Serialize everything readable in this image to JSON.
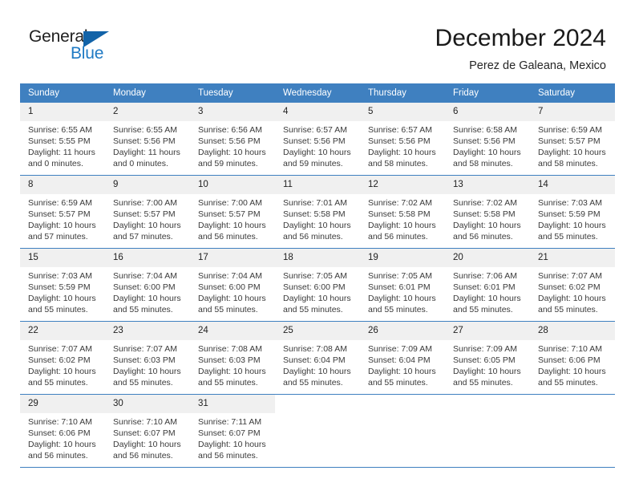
{
  "brand": {
    "name_top": "General",
    "name_bottom": "Blue",
    "triangle_icon": "triangle-icon",
    "accent_color": "#1263a8",
    "text_color": "#1f7ac4"
  },
  "header": {
    "title": "December 2024",
    "location": "Perez de Galeana, Mexico"
  },
  "calendar": {
    "header_bg": "#3f80c0",
    "header_text_color": "#ffffff",
    "daynum_bg": "#f0f0f0",
    "weekdays": [
      "Sunday",
      "Monday",
      "Tuesday",
      "Wednesday",
      "Thursday",
      "Friday",
      "Saturday"
    ],
    "labels": {
      "sunrise": "Sunrise:",
      "sunset": "Sunset:",
      "daylight": "Daylight:"
    },
    "weeks": [
      [
        {
          "day": "1",
          "sunrise": "Sunrise: 6:55 AM",
          "sunset": "Sunset: 5:55 PM",
          "daylight1": "Daylight: 11 hours",
          "daylight2": "and 0 minutes."
        },
        {
          "day": "2",
          "sunrise": "Sunrise: 6:55 AM",
          "sunset": "Sunset: 5:56 PM",
          "daylight1": "Daylight: 11 hours",
          "daylight2": "and 0 minutes."
        },
        {
          "day": "3",
          "sunrise": "Sunrise: 6:56 AM",
          "sunset": "Sunset: 5:56 PM",
          "daylight1": "Daylight: 10 hours",
          "daylight2": "and 59 minutes."
        },
        {
          "day": "4",
          "sunrise": "Sunrise: 6:57 AM",
          "sunset": "Sunset: 5:56 PM",
          "daylight1": "Daylight: 10 hours",
          "daylight2": "and 59 minutes."
        },
        {
          "day": "5",
          "sunrise": "Sunrise: 6:57 AM",
          "sunset": "Sunset: 5:56 PM",
          "daylight1": "Daylight: 10 hours",
          "daylight2": "and 58 minutes."
        },
        {
          "day": "6",
          "sunrise": "Sunrise: 6:58 AM",
          "sunset": "Sunset: 5:56 PM",
          "daylight1": "Daylight: 10 hours",
          "daylight2": "and 58 minutes."
        },
        {
          "day": "7",
          "sunrise": "Sunrise: 6:59 AM",
          "sunset": "Sunset: 5:57 PM",
          "daylight1": "Daylight: 10 hours",
          "daylight2": "and 58 minutes."
        }
      ],
      [
        {
          "day": "8",
          "sunrise": "Sunrise: 6:59 AM",
          "sunset": "Sunset: 5:57 PM",
          "daylight1": "Daylight: 10 hours",
          "daylight2": "and 57 minutes."
        },
        {
          "day": "9",
          "sunrise": "Sunrise: 7:00 AM",
          "sunset": "Sunset: 5:57 PM",
          "daylight1": "Daylight: 10 hours",
          "daylight2": "and 57 minutes."
        },
        {
          "day": "10",
          "sunrise": "Sunrise: 7:00 AM",
          "sunset": "Sunset: 5:57 PM",
          "daylight1": "Daylight: 10 hours",
          "daylight2": "and 56 minutes."
        },
        {
          "day": "11",
          "sunrise": "Sunrise: 7:01 AM",
          "sunset": "Sunset: 5:58 PM",
          "daylight1": "Daylight: 10 hours",
          "daylight2": "and 56 minutes."
        },
        {
          "day": "12",
          "sunrise": "Sunrise: 7:02 AM",
          "sunset": "Sunset: 5:58 PM",
          "daylight1": "Daylight: 10 hours",
          "daylight2": "and 56 minutes."
        },
        {
          "day": "13",
          "sunrise": "Sunrise: 7:02 AM",
          "sunset": "Sunset: 5:58 PM",
          "daylight1": "Daylight: 10 hours",
          "daylight2": "and 56 minutes."
        },
        {
          "day": "14",
          "sunrise": "Sunrise: 7:03 AM",
          "sunset": "Sunset: 5:59 PM",
          "daylight1": "Daylight: 10 hours",
          "daylight2": "and 55 minutes."
        }
      ],
      [
        {
          "day": "15",
          "sunrise": "Sunrise: 7:03 AM",
          "sunset": "Sunset: 5:59 PM",
          "daylight1": "Daylight: 10 hours",
          "daylight2": "and 55 minutes."
        },
        {
          "day": "16",
          "sunrise": "Sunrise: 7:04 AM",
          "sunset": "Sunset: 6:00 PM",
          "daylight1": "Daylight: 10 hours",
          "daylight2": "and 55 minutes."
        },
        {
          "day": "17",
          "sunrise": "Sunrise: 7:04 AM",
          "sunset": "Sunset: 6:00 PM",
          "daylight1": "Daylight: 10 hours",
          "daylight2": "and 55 minutes."
        },
        {
          "day": "18",
          "sunrise": "Sunrise: 7:05 AM",
          "sunset": "Sunset: 6:00 PM",
          "daylight1": "Daylight: 10 hours",
          "daylight2": "and 55 minutes."
        },
        {
          "day": "19",
          "sunrise": "Sunrise: 7:05 AM",
          "sunset": "Sunset: 6:01 PM",
          "daylight1": "Daylight: 10 hours",
          "daylight2": "and 55 minutes."
        },
        {
          "day": "20",
          "sunrise": "Sunrise: 7:06 AM",
          "sunset": "Sunset: 6:01 PM",
          "daylight1": "Daylight: 10 hours",
          "daylight2": "and 55 minutes."
        },
        {
          "day": "21",
          "sunrise": "Sunrise: 7:07 AM",
          "sunset": "Sunset: 6:02 PM",
          "daylight1": "Daylight: 10 hours",
          "daylight2": "and 55 minutes."
        }
      ],
      [
        {
          "day": "22",
          "sunrise": "Sunrise: 7:07 AM",
          "sunset": "Sunset: 6:02 PM",
          "daylight1": "Daylight: 10 hours",
          "daylight2": "and 55 minutes."
        },
        {
          "day": "23",
          "sunrise": "Sunrise: 7:07 AM",
          "sunset": "Sunset: 6:03 PM",
          "daylight1": "Daylight: 10 hours",
          "daylight2": "and 55 minutes."
        },
        {
          "day": "24",
          "sunrise": "Sunrise: 7:08 AM",
          "sunset": "Sunset: 6:03 PM",
          "daylight1": "Daylight: 10 hours",
          "daylight2": "and 55 minutes."
        },
        {
          "day": "25",
          "sunrise": "Sunrise: 7:08 AM",
          "sunset": "Sunset: 6:04 PM",
          "daylight1": "Daylight: 10 hours",
          "daylight2": "and 55 minutes."
        },
        {
          "day": "26",
          "sunrise": "Sunrise: 7:09 AM",
          "sunset": "Sunset: 6:04 PM",
          "daylight1": "Daylight: 10 hours",
          "daylight2": "and 55 minutes."
        },
        {
          "day": "27",
          "sunrise": "Sunrise: 7:09 AM",
          "sunset": "Sunset: 6:05 PM",
          "daylight1": "Daylight: 10 hours",
          "daylight2": "and 55 minutes."
        },
        {
          "day": "28",
          "sunrise": "Sunrise: 7:10 AM",
          "sunset": "Sunset: 6:06 PM",
          "daylight1": "Daylight: 10 hours",
          "daylight2": "and 55 minutes."
        }
      ],
      [
        {
          "day": "29",
          "sunrise": "Sunrise: 7:10 AM",
          "sunset": "Sunset: 6:06 PM",
          "daylight1": "Daylight: 10 hours",
          "daylight2": "and 56 minutes."
        },
        {
          "day": "30",
          "sunrise": "Sunrise: 7:10 AM",
          "sunset": "Sunset: 6:07 PM",
          "daylight1": "Daylight: 10 hours",
          "daylight2": "and 56 minutes."
        },
        {
          "day": "31",
          "sunrise": "Sunrise: 7:11 AM",
          "sunset": "Sunset: 6:07 PM",
          "daylight1": "Daylight: 10 hours",
          "daylight2": "and 56 minutes."
        },
        {
          "day": "",
          "sunrise": "",
          "sunset": "",
          "daylight1": "",
          "daylight2": ""
        },
        {
          "day": "",
          "sunrise": "",
          "sunset": "",
          "daylight1": "",
          "daylight2": ""
        },
        {
          "day": "",
          "sunrise": "",
          "sunset": "",
          "daylight1": "",
          "daylight2": ""
        },
        {
          "day": "",
          "sunrise": "",
          "sunset": "",
          "daylight1": "",
          "daylight2": ""
        }
      ]
    ]
  }
}
